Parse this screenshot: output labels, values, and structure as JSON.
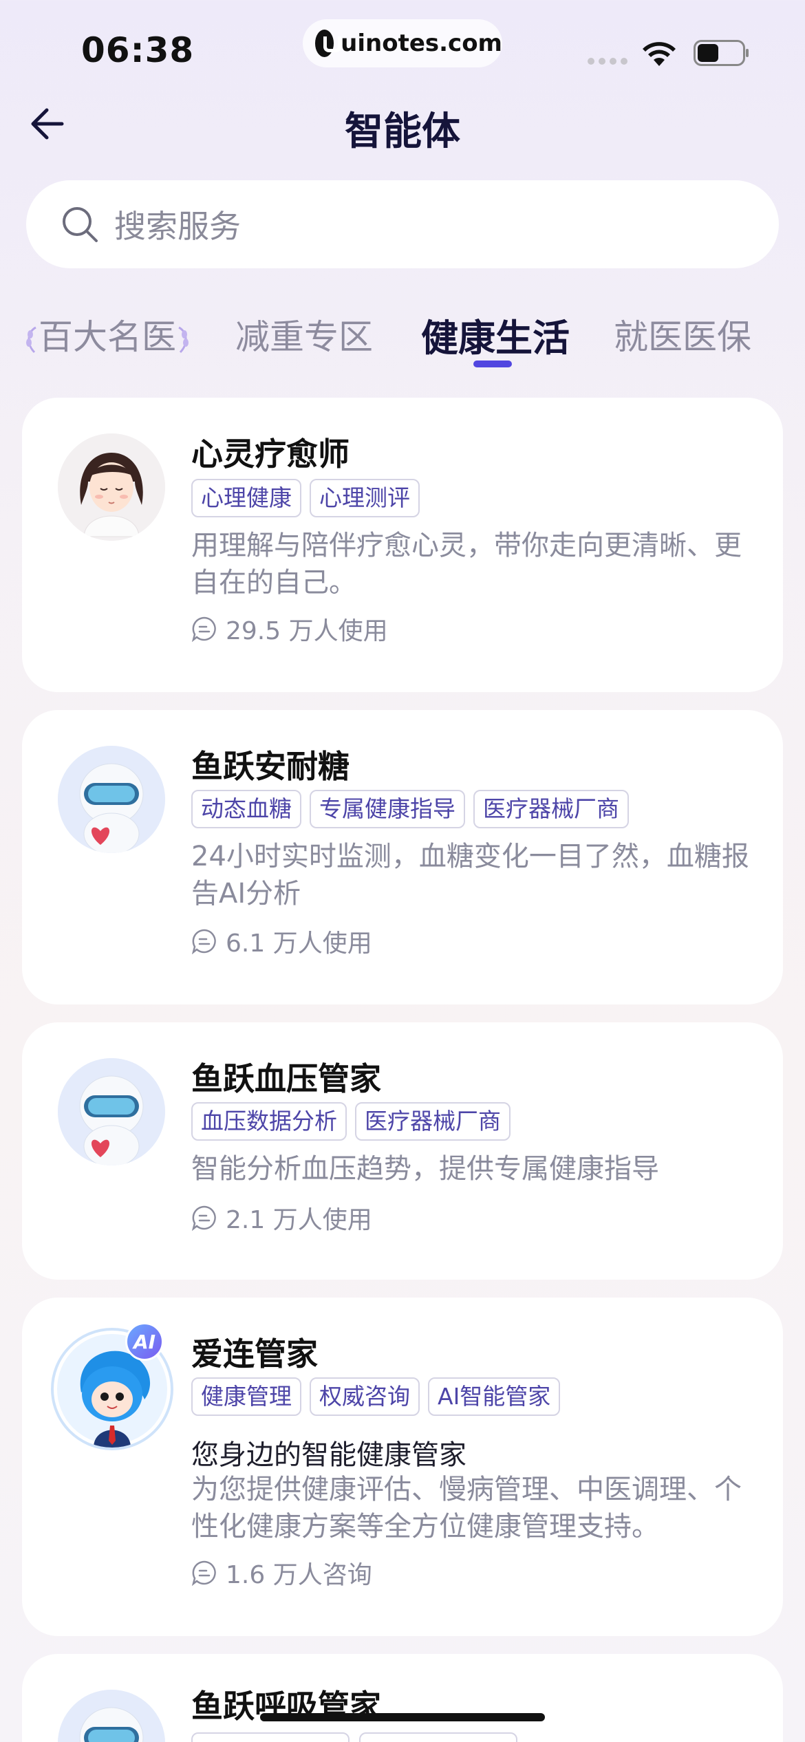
{
  "status_bar": {
    "time": "06:38",
    "url": "uinotes.com"
  },
  "header": {
    "title": "智能体"
  },
  "search": {
    "placeholder": "搜索服务"
  },
  "tabs": [
    {
      "label": "百大名医"
    },
    {
      "label": "减重专区"
    },
    {
      "label": "健康生活",
      "active": true
    },
    {
      "label": "就医医保"
    }
  ],
  "cards": [
    {
      "title": "心灵疗愈师",
      "tags": [
        "心理健康",
        "心理测评"
      ],
      "description": "用理解与陪伴疗愈心灵，带你走向更清晰、更自在的自己。",
      "usage": "29.5 万人使用"
    },
    {
      "title": "鱼跃安耐糖",
      "tags": [
        "动态血糖",
        "专属健康指导",
        "医疗器械厂商"
      ],
      "description": "24小时实时监测，血糖变化一目了然，血糖报告AI分析",
      "usage": "6.1 万人使用"
    },
    {
      "title": "鱼跃血压管家",
      "tags": [
        "血压数据分析",
        "医疗器械厂商"
      ],
      "description": "智能分析血压趋势，提供专属健康指导",
      "usage": "2.1 万人使用"
    },
    {
      "title": "爱连管家",
      "avatar_badge": "AI",
      "tags": [
        "健康管理",
        "权威咨询",
        "AI智能管家"
      ],
      "subtitle": "您身边的智能健康管家",
      "description": "为您提供健康评估、慢病管理、中医调理、个性化健康方案等全方位健康管理支持。",
      "usage": "1.6 万人咨询"
    },
    {
      "title": "鱼跃呼吸管家"
    }
  ],
  "colors": {
    "accent": "#5146e0",
    "tag_text": "#4d45a8",
    "muted": "#8a8b9c"
  }
}
